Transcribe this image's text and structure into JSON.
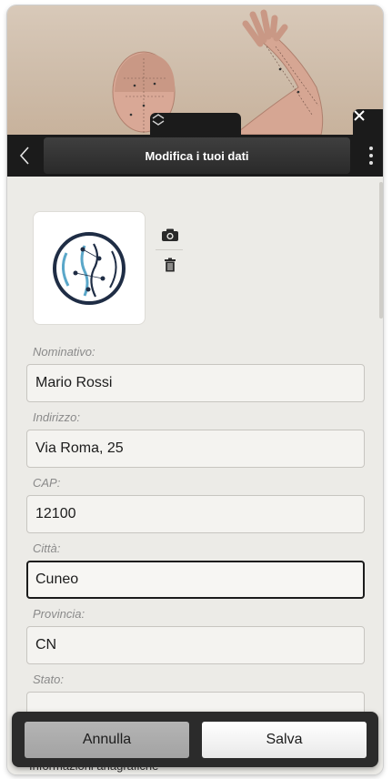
{
  "header": {
    "title": "Modifica i tuoi dati",
    "icons": {
      "back": "chevron-left-icon",
      "close": "close-icon",
      "menu": "more-vertical-icon",
      "collapse": "chevron-up-down-icon"
    }
  },
  "photo": {
    "logo_description": "spine-logo",
    "actions": [
      "camera-icon",
      "trash-icon"
    ]
  },
  "form": {
    "fields": [
      {
        "label": "Nominativo:",
        "value": "Mario Rossi"
      },
      {
        "label": "Indirizzo:",
        "value": "Via Roma, 25"
      },
      {
        "label": "CAP:",
        "value": "12100"
      },
      {
        "label": "Città:",
        "value": "Cuneo"
      },
      {
        "label": "Provincia:",
        "value": "CN"
      },
      {
        "label": "Stato:",
        "value": ""
      }
    ],
    "behind_text": "Informazioni anagrafiche"
  },
  "footer": {
    "cancel_label": "Annulla",
    "save_label": "Salva"
  },
  "colors": {
    "toolbar": "#1b1b1b",
    "background": "#ecebe7",
    "focus_border": "#1b1b1b",
    "logo_blue": "#5aa7c9",
    "logo_dark": "#1f2d45"
  }
}
